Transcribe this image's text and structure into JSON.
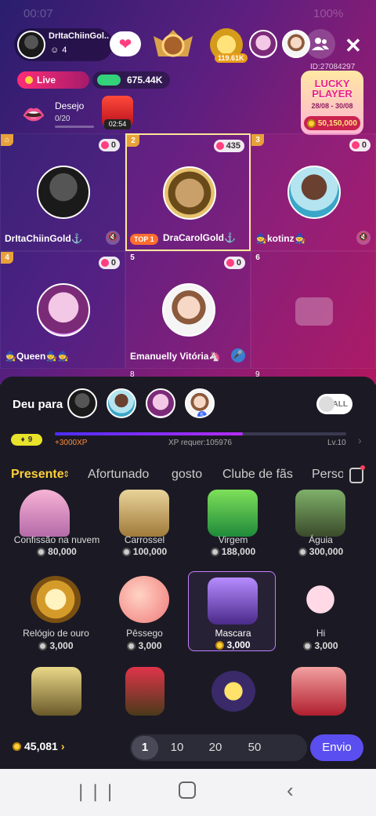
{
  "status_bar": {
    "time": "00:07",
    "right": "100%"
  },
  "host": {
    "name": "DrItaChiinGol..",
    "listeners": "4"
  },
  "top_bar": {
    "vip_label": "VIP",
    "vip_count": "119.61K",
    "room_id": "ID:27084297"
  },
  "live": {
    "label": "Live",
    "points": "675.44K"
  },
  "desejo": {
    "label": "Desejo",
    "value": "0/20"
  },
  "gift_timer": "02:54",
  "lucky": {
    "title": "LUCKY PLAYER",
    "dates": "28/08 - 30/08",
    "prize": "50,150,000"
  },
  "seats": [
    {
      "num": "",
      "name": "DrItaChiinGold⚓",
      "points": "0"
    },
    {
      "num": "2",
      "name": "DraCarolGold⚓",
      "points": "435",
      "badge": "TOP 1"
    },
    {
      "num": "3",
      "name": "🧙kotinz🧙",
      "points": "0"
    },
    {
      "num": "4",
      "name": "🧙Queen🧙🧙",
      "points": "0"
    },
    {
      "num": "5",
      "name": "Emanuelly Vitória🦄",
      "points": "0"
    },
    {
      "num": "6",
      "name": "",
      "points": ""
    }
  ],
  "row3": {
    "num8": "8",
    "num9": "9"
  },
  "gift_panel": {
    "deu_para": "Deu para",
    "receiver_num": "5",
    "toggle_label": "ALL",
    "level_badge": "9",
    "xp_plus": "+3000XP",
    "xp_required": "XP requer:105976",
    "level": "Lv.10",
    "tabs": [
      "Presente",
      "Afortunado",
      "gosto",
      "Clube de fãs",
      "Perso"
    ]
  },
  "gifts": [
    {
      "name": "Confissão na nuvem",
      "price": "80,000"
    },
    {
      "name": "Carrossel",
      "price": "100,000"
    },
    {
      "name": "Virgem",
      "price": "188,000"
    },
    {
      "name": "Águia",
      "price": "300,000"
    },
    {
      "name": "Relógio de ouro",
      "price": "3,000"
    },
    {
      "name": "Pêssego",
      "price": "3,000"
    },
    {
      "name": "Mascara",
      "price": "3,000"
    },
    {
      "name": "Hi",
      "price": "3,000"
    }
  ],
  "footer": {
    "balance": "45,081",
    "qty": [
      "1",
      "10",
      "20",
      "50"
    ],
    "send": "Envio"
  },
  "colors": {
    "accent": "#5b4ef0",
    "active_tab": "#ffcf3a",
    "live": "#ff2d77"
  }
}
